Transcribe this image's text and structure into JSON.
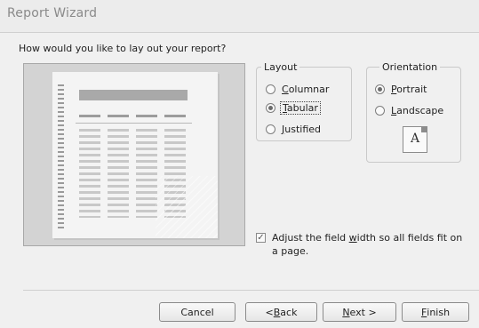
{
  "window": {
    "title": "Report Wizard"
  },
  "prompt": "How would you like to lay out your report?",
  "layout": {
    "legend": "Layout",
    "options": [
      {
        "pre": "",
        "key": "C",
        "post": "olumnar",
        "selected": false
      },
      {
        "pre": "",
        "key": "T",
        "post": "abular",
        "selected": true
      },
      {
        "pre": "",
        "key": "J",
        "post": "ustified",
        "selected": false
      }
    ]
  },
  "orientation": {
    "legend": "Orientation",
    "options": [
      {
        "pre": "",
        "key": "P",
        "post": "ortrait",
        "selected": true
      },
      {
        "pre": "",
        "key": "L",
        "post": "andscape",
        "selected": false
      }
    ],
    "icon_letter": "A"
  },
  "adjust": {
    "checked": true,
    "pre": "Adjust the field ",
    "key": "w",
    "post": "idth so all fields fit on a page."
  },
  "buttons": {
    "cancel": {
      "pre": "Cancel",
      "key": "",
      "post": ""
    },
    "back": {
      "pre": "< ",
      "key": "B",
      "post": "ack"
    },
    "next": {
      "pre": "",
      "key": "N",
      "post": "ext >"
    },
    "finish": {
      "pre": "",
      "key": "F",
      "post": "inish"
    }
  }
}
